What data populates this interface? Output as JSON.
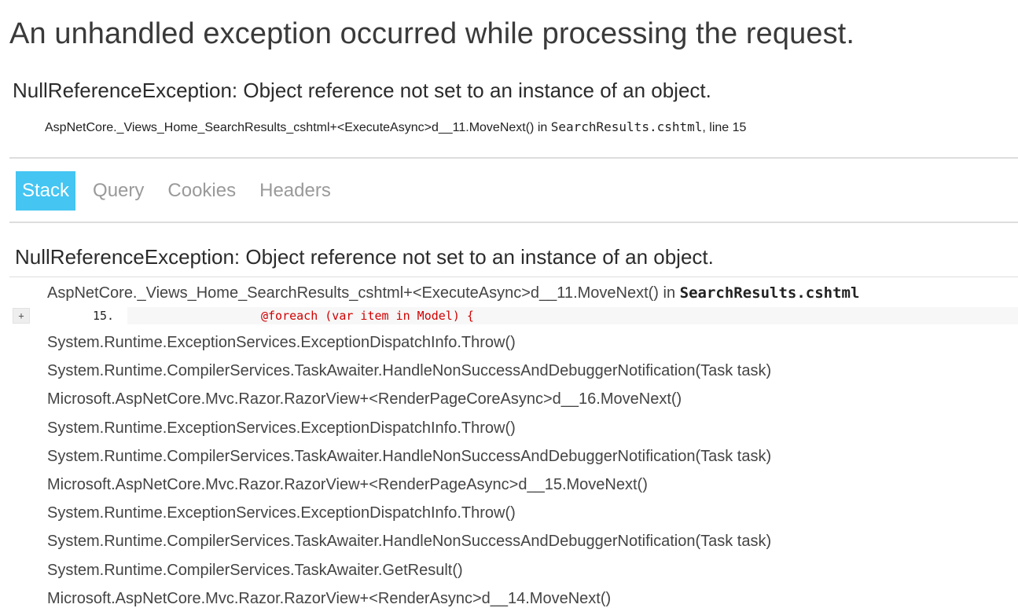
{
  "page": {
    "title": "An unhandled exception occurred while processing the request."
  },
  "error": {
    "heading": "NullReferenceException: Object reference not set to an instance of an object.",
    "location_method": "AspNetCore._Views_Home_SearchResults_cshtml+<ExecuteAsync>d__11.MoveNext() in ",
    "location_file": "SearchResults.cshtml",
    "location_line": ", line 15"
  },
  "tabs": [
    {
      "label": "Stack",
      "selected": true
    },
    {
      "label": "Query",
      "selected": false
    },
    {
      "label": "Cookies",
      "selected": false
    },
    {
      "label": "Headers",
      "selected": false
    }
  ],
  "stack": {
    "heading": "NullReferenceException: Object reference not set to an instance of an object.",
    "first_frame": {
      "method": "AspNetCore._Views_Home_SearchResults_cshtml+<ExecuteAsync>d__11.MoveNext() in ",
      "file": "SearchResults.cshtml",
      "expand_label": "+",
      "line_number": "15.",
      "code": "@foreach (var item in Model) {"
    },
    "frames": [
      "System.Runtime.ExceptionServices.ExceptionDispatchInfo.Throw()",
      "System.Runtime.CompilerServices.TaskAwaiter.HandleNonSuccessAndDebuggerNotification(Task task)",
      "Microsoft.AspNetCore.Mvc.Razor.RazorView+<RenderPageCoreAsync>d__16.MoveNext()",
      "System.Runtime.ExceptionServices.ExceptionDispatchInfo.Throw()",
      "System.Runtime.CompilerServices.TaskAwaiter.HandleNonSuccessAndDebuggerNotification(Task task)",
      "Microsoft.AspNetCore.Mvc.Razor.RazorView+<RenderPageAsync>d__15.MoveNext()",
      "System.Runtime.ExceptionServices.ExceptionDispatchInfo.Throw()",
      "System.Runtime.CompilerServices.TaskAwaiter.HandleNonSuccessAndDebuggerNotification(Task task)",
      "System.Runtime.CompilerServices.TaskAwaiter.GetResult()",
      "Microsoft.AspNetCore.Mvc.Razor.RazorView+<RenderAsync>d__14.MoveNext()"
    ]
  },
  "colors": {
    "tab_selected_bg": "#44c5f2",
    "code_highlight": "#d00000"
  }
}
